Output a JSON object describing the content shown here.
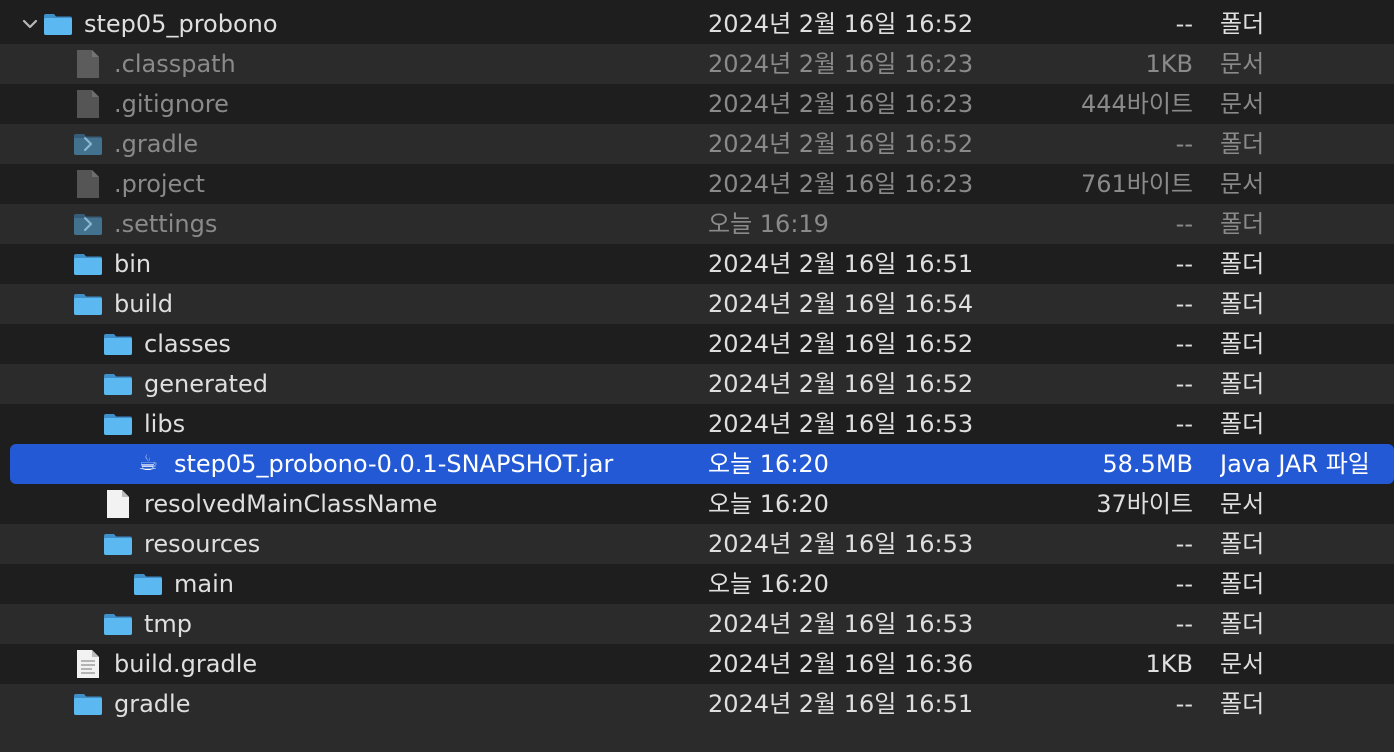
{
  "rows": [
    {
      "name": "step05_probono",
      "date": "2024년 2월 16일 16:52",
      "size": "--",
      "kind": "폴더",
      "type": "folder",
      "disclosure": "open",
      "dimmed": false,
      "selected": false
    },
    {
      "name": ".classpath",
      "date": "2024년 2월 16일 16:23",
      "size": "1KB",
      "kind": "문서",
      "type": "doc-grey",
      "disclosure": "none",
      "dimmed": true,
      "selected": false
    },
    {
      "name": ".gitignore",
      "date": "2024년 2월 16일 16:23",
      "size": "444바이트",
      "kind": "문서",
      "type": "doc-grey",
      "disclosure": "none",
      "dimmed": true,
      "selected": false
    },
    {
      "name": ".gradle",
      "date": "2024년 2월 16일 16:52",
      "size": "--",
      "kind": "폴더",
      "type": "folder",
      "disclosure": "closed",
      "dimmed": true,
      "selected": false
    },
    {
      "name": ".project",
      "date": "2024년 2월 16일 16:23",
      "size": "761바이트",
      "kind": "문서",
      "type": "doc-grey",
      "disclosure": "none",
      "dimmed": true,
      "selected": false
    },
    {
      "name": ".settings",
      "date": "오늘 16:19",
      "size": "--",
      "kind": "폴더",
      "type": "folder",
      "disclosure": "closed",
      "dimmed": true,
      "selected": false
    },
    {
      "name": "bin",
      "date": "2024년 2월 16일 16:51",
      "size": "--",
      "kind": "폴더",
      "type": "folder",
      "disclosure": "closed",
      "dimmed": false,
      "selected": false
    },
    {
      "name": "build",
      "date": "2024년 2월 16일 16:54",
      "size": "--",
      "kind": "폴더",
      "type": "folder",
      "disclosure": "open",
      "dimmed": false,
      "selected": false
    },
    {
      "name": "classes",
      "date": "2024년 2월 16일 16:52",
      "size": "--",
      "kind": "폴더",
      "type": "folder",
      "disclosure": "closed",
      "dimmed": false,
      "selected": false
    },
    {
      "name": "generated",
      "date": "2024년 2월 16일 16:52",
      "size": "--",
      "kind": "폴더",
      "type": "folder",
      "disclosure": "closed",
      "dimmed": false,
      "selected": false
    },
    {
      "name": "libs",
      "date": "2024년 2월 16일 16:53",
      "size": "--",
      "kind": "폴더",
      "type": "folder",
      "disclosure": "open",
      "dimmed": false,
      "selected": false
    },
    {
      "name": "step05_probono-0.0.1-SNAPSHOT.jar",
      "date": "오늘 16:20",
      "size": "58.5MB",
      "kind": "Java JAR 파일",
      "type": "jar",
      "disclosure": "none",
      "dimmed": false,
      "selected": true
    },
    {
      "name": "resolvedMainClassName",
      "date": "오늘 16:20",
      "size": "37바이트",
      "kind": "문서",
      "type": "doc-white",
      "disclosure": "none",
      "dimmed": false,
      "selected": false
    },
    {
      "name": "resources",
      "date": "2024년 2월 16일 16:53",
      "size": "--",
      "kind": "폴더",
      "type": "folder",
      "disclosure": "open",
      "dimmed": false,
      "selected": false
    },
    {
      "name": "main",
      "date": "오늘 16:20",
      "size": "--",
      "kind": "폴더",
      "type": "folder",
      "disclosure": "closed",
      "dimmed": false,
      "selected": false
    },
    {
      "name": "tmp",
      "date": "2024년 2월 16일 16:53",
      "size": "--",
      "kind": "폴더",
      "type": "folder",
      "disclosure": "closed",
      "dimmed": false,
      "selected": false
    },
    {
      "name": "build.gradle",
      "date": "2024년 2월 16일 16:36",
      "size": "1KB",
      "kind": "문서",
      "type": "doc-lines",
      "disclosure": "none",
      "dimmed": false,
      "selected": false
    },
    {
      "name": "gradle",
      "date": "2024년 2월 16일 16:51",
      "size": "--",
      "kind": "폴더",
      "type": "folder",
      "disclosure": "open",
      "dimmed": false,
      "selected": false
    }
  ],
  "colors": {
    "background": "#1e1e1e",
    "stripe": "#2b2b2b",
    "selection": "#2359d5",
    "folder": "#5cb8f0",
    "text": "#dfdfdf",
    "dimmed_text": "#8a8a8a"
  }
}
